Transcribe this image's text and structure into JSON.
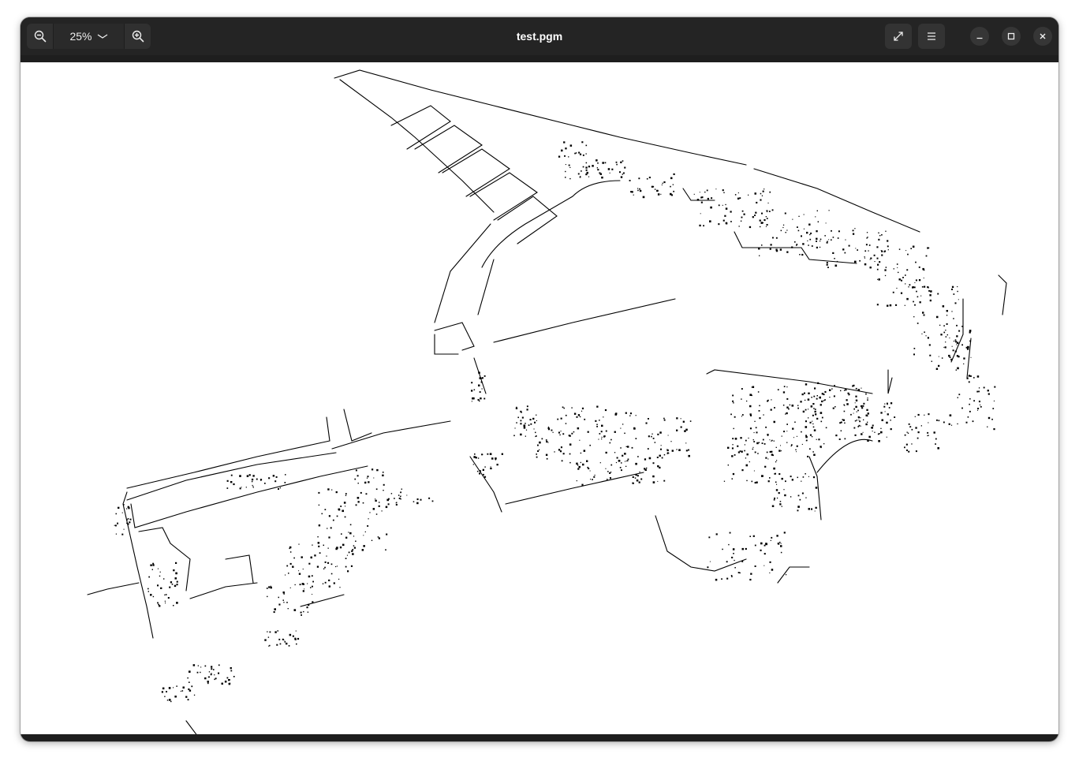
{
  "window": {
    "title": "test.pgm"
  },
  "toolbar": {
    "zoom_level": "25%",
    "zoom_out_icon": "zoom-out-icon",
    "zoom_in_icon": "zoom-in-icon",
    "zoom_dropdown_icon": "chevron-down-icon",
    "fullscreen_icon": "fullscreen-icon",
    "menu_icon": "hamburger-menu-icon",
    "minimize_icon": "minimize-icon",
    "maximize_icon": "maximize-icon",
    "close_icon": "close-icon"
  },
  "colors": {
    "headerbar": "#242424",
    "button": "#303030",
    "map_occupied": "#000000",
    "map_free": "#ffffff"
  }
}
